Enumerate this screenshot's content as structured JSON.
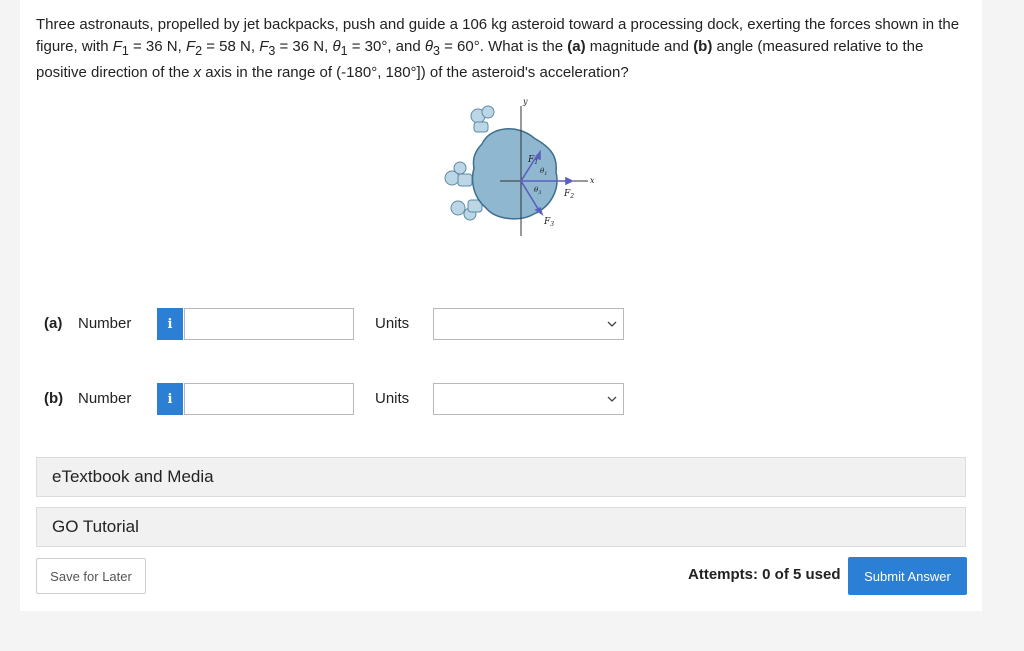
{
  "question": {
    "p1": "Three astronauts, propelled by jet backpacks, push and guide a 106 kg asteroid toward a processing dock, exerting the forces shown in the figure, with ",
    "f1": "F",
    "f1_sub": "1",
    "p2": " = 36 N, ",
    "f2": "F",
    "f2_sub": "2",
    "p3": " = 58 N, ",
    "f3": "F",
    "f3_sub": "3",
    "p4": " = 36 N, ",
    "t1": "θ",
    "t1_sub": "1",
    "p5": " = 30°, and ",
    "t3": "θ",
    "t3_sub": "3",
    "p6": " = 60°. What is the ",
    "a_tag": "(a)",
    "p7": " magnitude and ",
    "b_tag": "(b)",
    "p8": " angle (measured relative to the positive direction of the ",
    "x_var": "x",
    "p9": " axis in the range of (-180°, 180°]) of the asteroid's acceleration?"
  },
  "figure": {
    "y_axis": "y",
    "x_axis": "x",
    "f1_label": "F",
    "f1_sub": "1",
    "f2_label": "F",
    "f2_sub": "2",
    "f3_label": "F",
    "f3_sub": "3",
    "theta1": "θ",
    "theta1_sub": "1",
    "theta3": "θ",
    "theta3_sub": "3"
  },
  "answers": [
    {
      "part": "(a)",
      "label": "Number",
      "info": "i",
      "value": "",
      "units_label": "Units",
      "units_value": ""
    },
    {
      "part": "(b)",
      "label": "Number",
      "info": "i",
      "value": "",
      "units_label": "Units",
      "units_value": ""
    }
  ],
  "panels": {
    "etextbook": "eTextbook and Media",
    "go_tutorial": "GO Tutorial"
  },
  "footer": {
    "save": "Save for Later",
    "attempts": "Attempts: 0 of 5 used",
    "submit": "Submit Answer"
  },
  "colors": {
    "accent": "#2b7fd4",
    "asteroid": "#8fb8d0",
    "vector": "#5a5fc0"
  }
}
